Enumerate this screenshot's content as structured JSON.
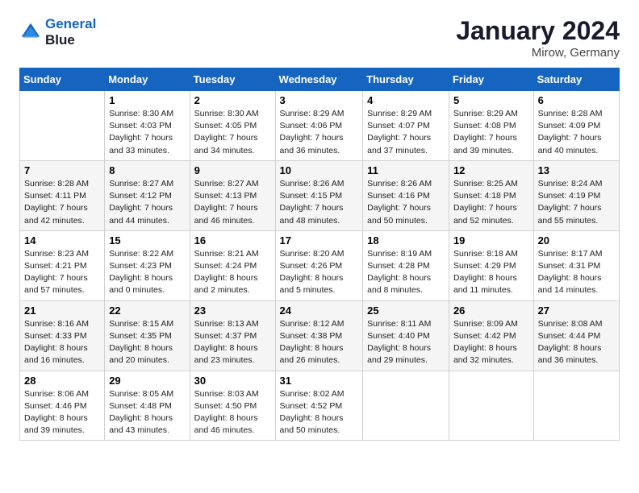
{
  "header": {
    "logo_line1": "General",
    "logo_line2": "Blue",
    "month": "January 2024",
    "location": "Mirow, Germany"
  },
  "days_of_week": [
    "Sunday",
    "Monday",
    "Tuesday",
    "Wednesday",
    "Thursday",
    "Friday",
    "Saturday"
  ],
  "weeks": [
    [
      {
        "day": "",
        "sunrise": "",
        "sunset": "",
        "daylight": ""
      },
      {
        "day": "1",
        "sunrise": "Sunrise: 8:30 AM",
        "sunset": "Sunset: 4:03 PM",
        "daylight": "Daylight: 7 hours and 33 minutes."
      },
      {
        "day": "2",
        "sunrise": "Sunrise: 8:30 AM",
        "sunset": "Sunset: 4:05 PM",
        "daylight": "Daylight: 7 hours and 34 minutes."
      },
      {
        "day": "3",
        "sunrise": "Sunrise: 8:29 AM",
        "sunset": "Sunset: 4:06 PM",
        "daylight": "Daylight: 7 hours and 36 minutes."
      },
      {
        "day": "4",
        "sunrise": "Sunrise: 8:29 AM",
        "sunset": "Sunset: 4:07 PM",
        "daylight": "Daylight: 7 hours and 37 minutes."
      },
      {
        "day": "5",
        "sunrise": "Sunrise: 8:29 AM",
        "sunset": "Sunset: 4:08 PM",
        "daylight": "Daylight: 7 hours and 39 minutes."
      },
      {
        "day": "6",
        "sunrise": "Sunrise: 8:28 AM",
        "sunset": "Sunset: 4:09 PM",
        "daylight": "Daylight: 7 hours and 40 minutes."
      }
    ],
    [
      {
        "day": "7",
        "sunrise": "Sunrise: 8:28 AM",
        "sunset": "Sunset: 4:11 PM",
        "daylight": "Daylight: 7 hours and 42 minutes."
      },
      {
        "day": "8",
        "sunrise": "Sunrise: 8:27 AM",
        "sunset": "Sunset: 4:12 PM",
        "daylight": "Daylight: 7 hours and 44 minutes."
      },
      {
        "day": "9",
        "sunrise": "Sunrise: 8:27 AM",
        "sunset": "Sunset: 4:13 PM",
        "daylight": "Daylight: 7 hours and 46 minutes."
      },
      {
        "day": "10",
        "sunrise": "Sunrise: 8:26 AM",
        "sunset": "Sunset: 4:15 PM",
        "daylight": "Daylight: 7 hours and 48 minutes."
      },
      {
        "day": "11",
        "sunrise": "Sunrise: 8:26 AM",
        "sunset": "Sunset: 4:16 PM",
        "daylight": "Daylight: 7 hours and 50 minutes."
      },
      {
        "day": "12",
        "sunrise": "Sunrise: 8:25 AM",
        "sunset": "Sunset: 4:18 PM",
        "daylight": "Daylight: 7 hours and 52 minutes."
      },
      {
        "day": "13",
        "sunrise": "Sunrise: 8:24 AM",
        "sunset": "Sunset: 4:19 PM",
        "daylight": "Daylight: 7 hours and 55 minutes."
      }
    ],
    [
      {
        "day": "14",
        "sunrise": "Sunrise: 8:23 AM",
        "sunset": "Sunset: 4:21 PM",
        "daylight": "Daylight: 7 hours and 57 minutes."
      },
      {
        "day": "15",
        "sunrise": "Sunrise: 8:22 AM",
        "sunset": "Sunset: 4:23 PM",
        "daylight": "Daylight: 8 hours and 0 minutes."
      },
      {
        "day": "16",
        "sunrise": "Sunrise: 8:21 AM",
        "sunset": "Sunset: 4:24 PM",
        "daylight": "Daylight: 8 hours and 2 minutes."
      },
      {
        "day": "17",
        "sunrise": "Sunrise: 8:20 AM",
        "sunset": "Sunset: 4:26 PM",
        "daylight": "Daylight: 8 hours and 5 minutes."
      },
      {
        "day": "18",
        "sunrise": "Sunrise: 8:19 AM",
        "sunset": "Sunset: 4:28 PM",
        "daylight": "Daylight: 8 hours and 8 minutes."
      },
      {
        "day": "19",
        "sunrise": "Sunrise: 8:18 AM",
        "sunset": "Sunset: 4:29 PM",
        "daylight": "Daylight: 8 hours and 11 minutes."
      },
      {
        "day": "20",
        "sunrise": "Sunrise: 8:17 AM",
        "sunset": "Sunset: 4:31 PM",
        "daylight": "Daylight: 8 hours and 14 minutes."
      }
    ],
    [
      {
        "day": "21",
        "sunrise": "Sunrise: 8:16 AM",
        "sunset": "Sunset: 4:33 PM",
        "daylight": "Daylight: 8 hours and 16 minutes."
      },
      {
        "day": "22",
        "sunrise": "Sunrise: 8:15 AM",
        "sunset": "Sunset: 4:35 PM",
        "daylight": "Daylight: 8 hours and 20 minutes."
      },
      {
        "day": "23",
        "sunrise": "Sunrise: 8:13 AM",
        "sunset": "Sunset: 4:37 PM",
        "daylight": "Daylight: 8 hours and 23 minutes."
      },
      {
        "day": "24",
        "sunrise": "Sunrise: 8:12 AM",
        "sunset": "Sunset: 4:38 PM",
        "daylight": "Daylight: 8 hours and 26 minutes."
      },
      {
        "day": "25",
        "sunrise": "Sunrise: 8:11 AM",
        "sunset": "Sunset: 4:40 PM",
        "daylight": "Daylight: 8 hours and 29 minutes."
      },
      {
        "day": "26",
        "sunrise": "Sunrise: 8:09 AM",
        "sunset": "Sunset: 4:42 PM",
        "daylight": "Daylight: 8 hours and 32 minutes."
      },
      {
        "day": "27",
        "sunrise": "Sunrise: 8:08 AM",
        "sunset": "Sunset: 4:44 PM",
        "daylight": "Daylight: 8 hours and 36 minutes."
      }
    ],
    [
      {
        "day": "28",
        "sunrise": "Sunrise: 8:06 AM",
        "sunset": "Sunset: 4:46 PM",
        "daylight": "Daylight: 8 hours and 39 minutes."
      },
      {
        "day": "29",
        "sunrise": "Sunrise: 8:05 AM",
        "sunset": "Sunset: 4:48 PM",
        "daylight": "Daylight: 8 hours and 43 minutes."
      },
      {
        "day": "30",
        "sunrise": "Sunrise: 8:03 AM",
        "sunset": "Sunset: 4:50 PM",
        "daylight": "Daylight: 8 hours and 46 minutes."
      },
      {
        "day": "31",
        "sunrise": "Sunrise: 8:02 AM",
        "sunset": "Sunset: 4:52 PM",
        "daylight": "Daylight: 8 hours and 50 minutes."
      },
      {
        "day": "",
        "sunrise": "",
        "sunset": "",
        "daylight": ""
      },
      {
        "day": "",
        "sunrise": "",
        "sunset": "",
        "daylight": ""
      },
      {
        "day": "",
        "sunrise": "",
        "sunset": "",
        "daylight": ""
      }
    ]
  ]
}
